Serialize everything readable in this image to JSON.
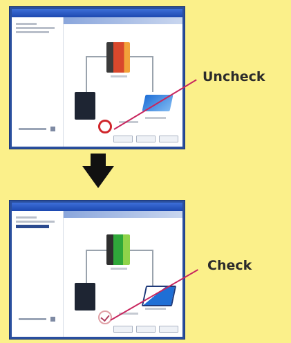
{
  "before": {
    "callout": "Uncheck"
  },
  "after": {
    "callout": "Check"
  },
  "icons": {
    "arrow": "down-arrow-icon",
    "device_top": "printer-icon",
    "device_left": "dark-device-icon",
    "device_right": "scanner-icon",
    "checkbox_uncheck": "checkbox-icon",
    "checkbox_check": "checked-checkbox-icon"
  },
  "colors": {
    "background": "#fbf08a",
    "window_border": "#2a4f9e",
    "highlight": "#d0262b",
    "pointer": "#c8265e",
    "arrow": "#111111"
  }
}
